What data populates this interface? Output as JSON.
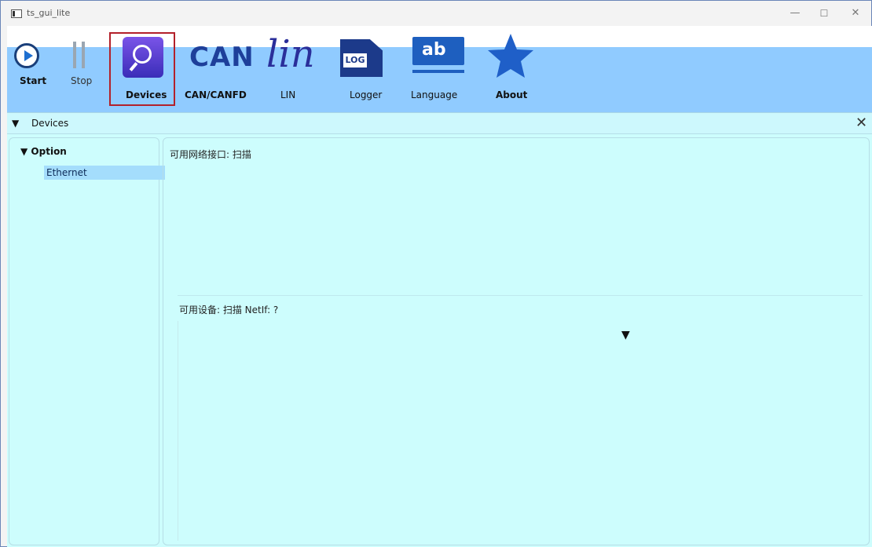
{
  "window": {
    "title": "ts_gui_lite"
  },
  "window_controls": {
    "minimize": "—",
    "maximize": "☐",
    "close": "✕"
  },
  "toolbar": {
    "start_label": "Start",
    "stop_label": "Stop",
    "devices_label": "Devices",
    "can_label": "CAN/CANFD",
    "can_icon_text": "CAN",
    "lin_label": "LIN",
    "lin_icon_text": "lin",
    "logger_label": "Logger",
    "logger_icon_text": "LOG",
    "language_label": "Language",
    "language_icon_text": "ab",
    "about_label": "About"
  },
  "panel": {
    "title": "Devices",
    "collapse_arrow": "▼",
    "close": "✕"
  },
  "options": {
    "title": "Option",
    "arrow": "▼",
    "items": [
      "Ethernet"
    ]
  },
  "main": {
    "netif_label": "可用网络接口:  扫描",
    "devices_label": "可用设备:  扫描    NetIf: ?",
    "devices_dropdown_arrow": "▼"
  },
  "colors": {
    "toolbar_band": "#90cbff",
    "content_bg": "#cdfdfd",
    "selection": "#a4ddfc",
    "accent_frame": "#b3202a"
  }
}
